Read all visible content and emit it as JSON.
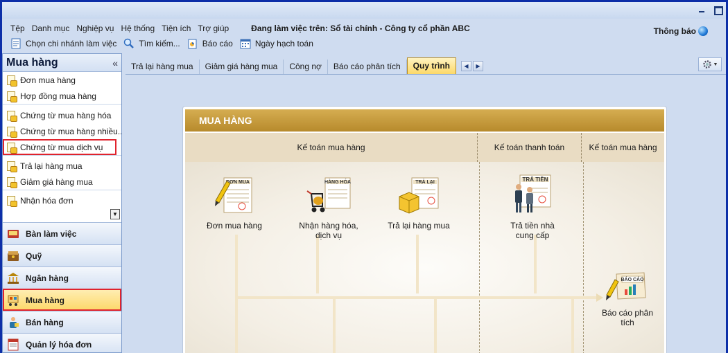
{
  "menu": {
    "items": [
      "Tệp",
      "Danh mục",
      "Nghiệp vụ",
      "Hệ thống",
      "Tiện ích",
      "Trợ giúp"
    ],
    "working_on": "Đang làm việc trên: Sổ tài chính - Công ty cổ phần ABC"
  },
  "notify": {
    "label": "Thông báo",
    "icon": "globe-icon"
  },
  "window_buttons": {
    "minimize": "minimize",
    "maximize": "maximize"
  },
  "toolbar": {
    "branch": "Chọn chi nhánh làm việc",
    "search": "Tìm kiếm...",
    "report": "Báo cáo",
    "post_date": "Ngày hạch toán"
  },
  "sidebar": {
    "title": "Mua hàng",
    "collapse": "«",
    "groups": [
      [
        "Đơn mua hàng",
        "Hợp đồng mua hàng"
      ],
      [
        "Chứng từ mua hàng hóa",
        "Chứng từ mua  hàng nhiều...",
        "Chứng từ mua dịch vụ"
      ],
      [
        "Trả lại hàng mua",
        "Giảm giá hàng mua"
      ],
      [
        "Nhận hóa đơn"
      ]
    ]
  },
  "modules": [
    "Bàn làm việc",
    "Quỹ",
    "Ngân hàng",
    "Mua hàng",
    "Bán hàng",
    "Quản lý hóa đơn"
  ],
  "tabs": [
    "Trả lại hàng mua",
    "Giảm giá hàng mua",
    "Công nợ",
    "Báo cáo phân tích",
    "Quy trình"
  ],
  "tab_nav": {
    "prev": "◀",
    "next": "▶"
  },
  "gear": {
    "caret": "▼"
  },
  "process": {
    "title": "MUA HÀNG",
    "columns": [
      "Kế toán mua hàng",
      "Kế toán thanh toán",
      "Kế toán mua hàng"
    ],
    "nodes": {
      "order": {
        "label": "Đơn mua hàng",
        "badge": "ĐƠN MUA"
      },
      "receive": {
        "line1": "Nhận hàng hóa,",
        "line2": "dịch vụ",
        "badge": "HÀNG HÓA"
      },
      "return": {
        "label": "Trả lại hàng mua",
        "badge": "TRẢ LẠI"
      },
      "pay": {
        "line1": "Trả tiền nhà",
        "line2": "cung cấp",
        "badge": "TRẢ TIỀN"
      },
      "report": {
        "line1": "Báo cáo phân",
        "line2": "tích",
        "badge": "BÁO CÁO"
      }
    }
  }
}
